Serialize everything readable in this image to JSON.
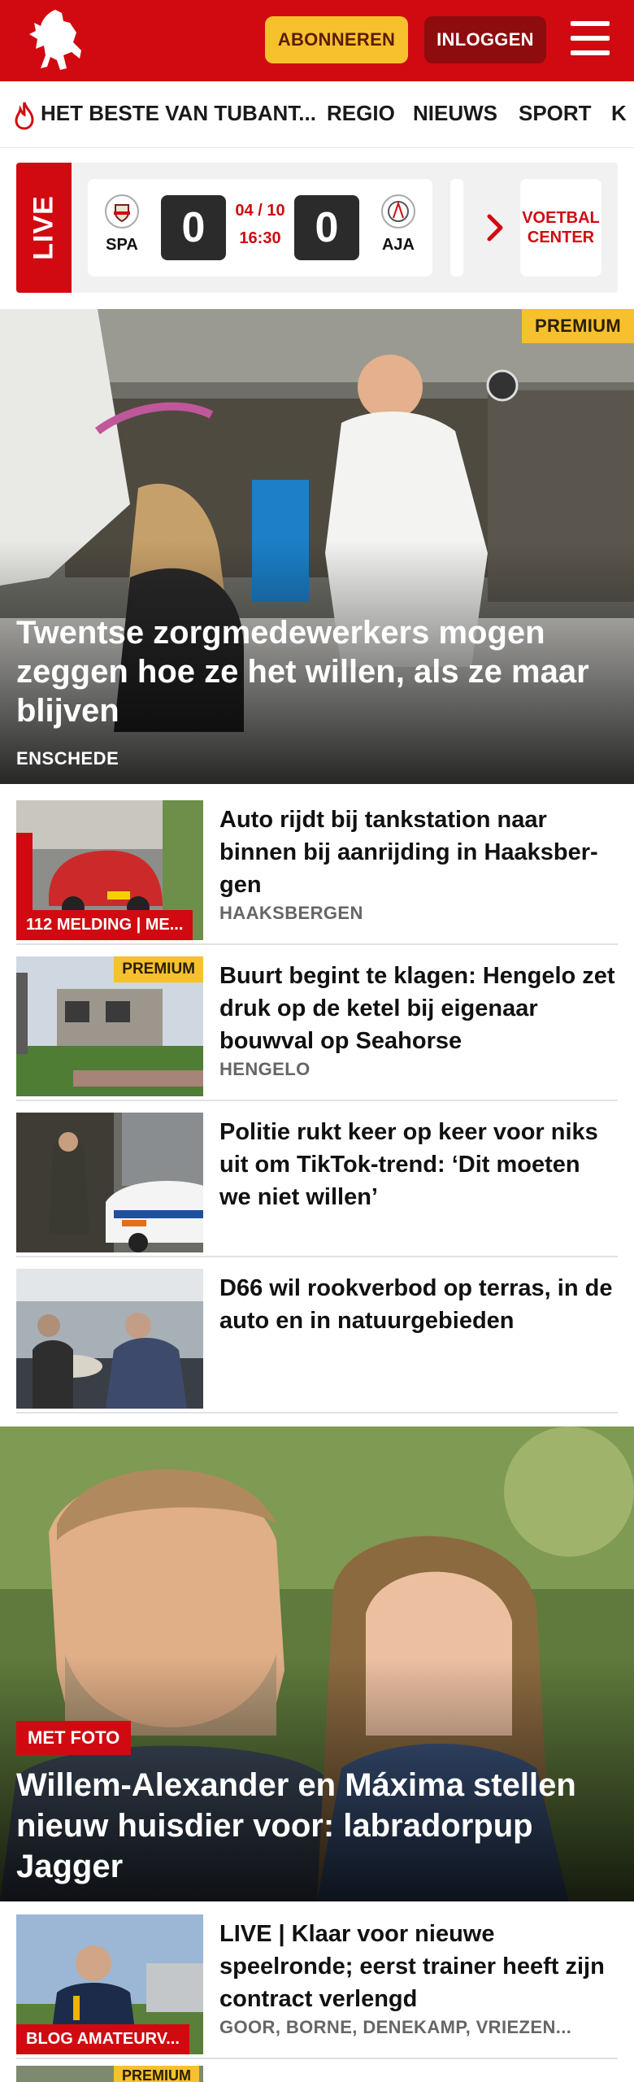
{
  "header": {
    "logo": "tubantia-horse-logo",
    "subscribe_label": "ABONNEREN",
    "login_label": "INLOGGEN",
    "menu_icon": "hamburger-menu-icon",
    "brand_color": "#d10a11",
    "accent_color": "#f7c02d"
  },
  "nav": {
    "items": [
      {
        "label": "HET BESTE VAN TUBANT...",
        "icon": "flame-icon"
      },
      {
        "label": "REGIO"
      },
      {
        "label": "NIEUWS"
      },
      {
        "label": "SPORT"
      },
      {
        "label": "K"
      }
    ]
  },
  "live": {
    "tag": "LIVE",
    "match": {
      "home": "SPA",
      "away": "AJA",
      "home_score": "0",
      "away_score": "0",
      "date": "04 / 10",
      "time": "16:30"
    },
    "voetbal_center_line1": "VOETBAL",
    "voetbal_center_line2": "CENTER"
  },
  "hero": {
    "badge": "PREMIUM",
    "title": "Twentse zorgmedewerkers mogen zeggen hoe ze het willen, als ze maar blijven",
    "location": "ENSCHEDE"
  },
  "articles": [
    {
      "title": "Auto rijdt bij tankstation naar binnen bij aanrijding in Haaksber-gen",
      "location": "HAAKSBERGEN",
      "label": "112 MELDING | ME...",
      "premium": ""
    },
    {
      "title": "Buurt begint te klagen: Hengelo zet druk op de ketel bij eigenaar bouwval op Seahorse",
      "location": "HENGELO",
      "label": "",
      "premium": "PREMIUM"
    },
    {
      "title": "Politie rukt keer op keer voor niks uit om TikTok-trend: ‘Dit moeten we niet willen’",
      "location": "",
      "label": "",
      "premium": ""
    },
    {
      "title": "D66 wil rookverbod op terras, in de auto en in natuurgebieden",
      "location": "",
      "label": "",
      "premium": ""
    }
  ],
  "hero2": {
    "tag": "MET FOTO",
    "title": "Willem-Alexander en Máxima stellen nieuw huisdier voor: labradorpup Jagger"
  },
  "articles2": [
    {
      "title": "LIVE | Klaar voor nieuwe speelronde; eerst trainer heeft zijn contract verlengd",
      "location": "GOOR, BORNE, DENEKAMP, VRIEZEN...",
      "label": "BLOG AMATEURV...",
      "premium": ""
    }
  ],
  "next_item_premium": "PREMIUM"
}
